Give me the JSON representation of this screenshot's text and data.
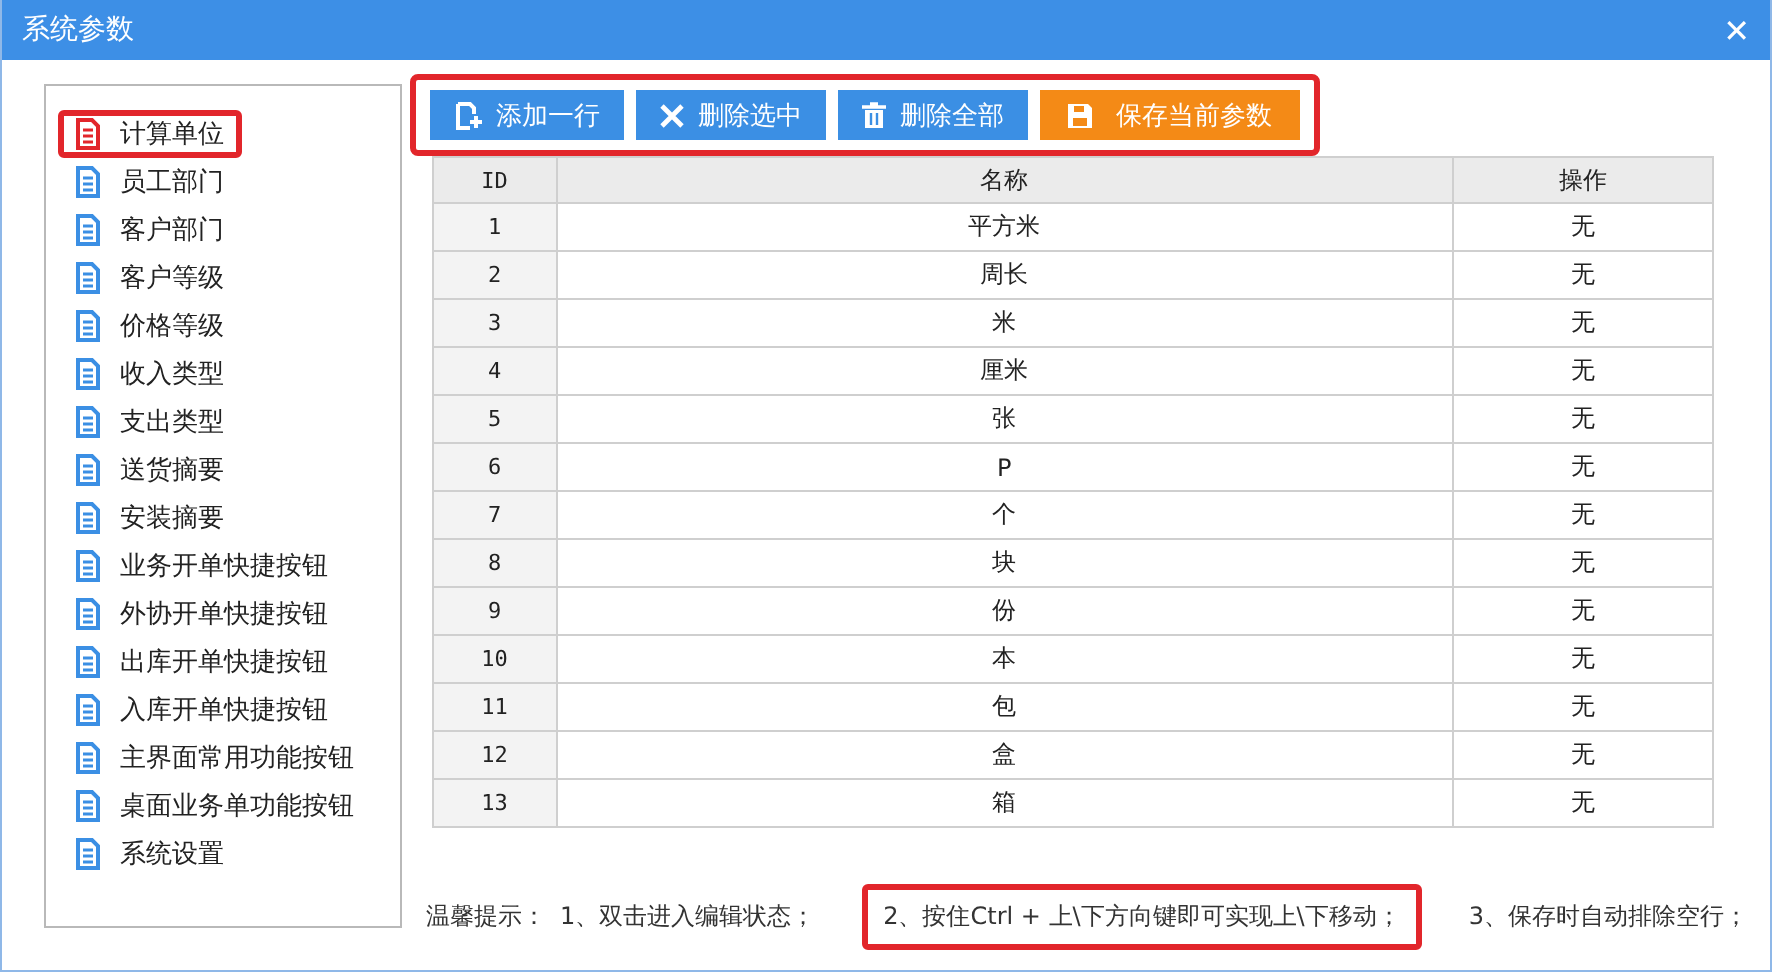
{
  "window": {
    "title": "系统参数",
    "close": "✕"
  },
  "sidebar": {
    "items": [
      {
        "label": "计算单位",
        "selected": true
      },
      {
        "label": "员工部门",
        "selected": false
      },
      {
        "label": "客户部门",
        "selected": false
      },
      {
        "label": "客户等级",
        "selected": false
      },
      {
        "label": "价格等级",
        "selected": false
      },
      {
        "label": "收入类型",
        "selected": false
      },
      {
        "label": "支出类型",
        "selected": false
      },
      {
        "label": "送货摘要",
        "selected": false
      },
      {
        "label": "安装摘要",
        "selected": false
      },
      {
        "label": "业务开单快捷按钮",
        "selected": false
      },
      {
        "label": "外协开单快捷按钮",
        "selected": false
      },
      {
        "label": "出库开单快捷按钮",
        "selected": false
      },
      {
        "label": "入库开单快捷按钮",
        "selected": false
      },
      {
        "label": "主界面常用功能按钮",
        "selected": false
      },
      {
        "label": "桌面业务单功能按钮",
        "selected": false
      },
      {
        "label": "系统设置",
        "selected": false
      }
    ]
  },
  "toolbar": {
    "highlighted": true,
    "buttons": [
      {
        "label": "添加一行",
        "kind": "add"
      },
      {
        "label": "删除选中",
        "kind": "delete"
      },
      {
        "label": "删除全部",
        "kind": "clear"
      },
      {
        "label": "保存当前参数",
        "kind": "save"
      }
    ]
  },
  "table": {
    "columns": [
      "ID",
      "名称",
      "操作"
    ],
    "rows": [
      [
        "1",
        "平方米",
        "无"
      ],
      [
        "2",
        "周长",
        "无"
      ],
      [
        "3",
        "米",
        "无"
      ],
      [
        "4",
        "厘米",
        "无"
      ],
      [
        "5",
        "张",
        "无"
      ],
      [
        "6",
        "P",
        "无"
      ],
      [
        "7",
        "个",
        "无"
      ],
      [
        "8",
        "块",
        "无"
      ],
      [
        "9",
        "份",
        "无"
      ],
      [
        "10",
        "本",
        "无"
      ],
      [
        "11",
        "包",
        "无"
      ],
      [
        "12",
        "盒",
        "无"
      ],
      [
        "13",
        "箱",
        "无"
      ]
    ]
  },
  "hints": {
    "label": "温馨提示：",
    "items": [
      {
        "text": "1、双击进入编辑状态；",
        "highlighted": false
      },
      {
        "text": "2、按住Ctrl + 上\\下方向键即可实现上\\下移动；",
        "highlighted": true
      },
      {
        "text": "3、保存时自动排除空行；",
        "highlighted": false
      }
    ]
  }
}
